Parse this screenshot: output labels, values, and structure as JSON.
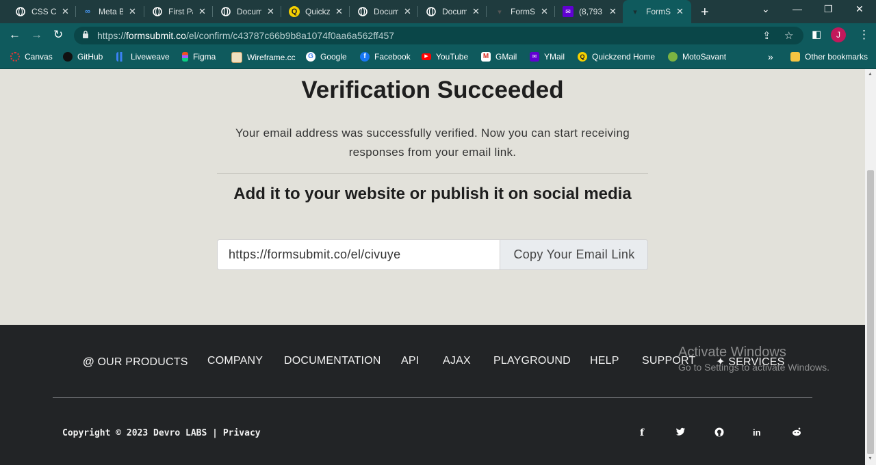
{
  "browser": {
    "tabs": [
      {
        "title": "CSS Ca",
        "icon": "globe-icon"
      },
      {
        "title": "Meta B",
        "icon": "meta-icon"
      },
      {
        "title": "First Pa",
        "icon": "globe-icon"
      },
      {
        "title": "Docum",
        "icon": "globe-icon"
      },
      {
        "title": "Quickz",
        "icon": "quickzend-icon"
      },
      {
        "title": "Docum",
        "icon": "globe-icon"
      },
      {
        "title": "Docum",
        "icon": "globe-icon"
      },
      {
        "title": "FormSu",
        "icon": "formsubmit-icon"
      },
      {
        "title": "(8,793",
        "icon": "yahoo-mail-icon"
      },
      {
        "title": "FormSu",
        "icon": "formsubmit-icon",
        "active": true
      }
    ],
    "url_prefix": "https://",
    "url_domain": "formsubmit.co",
    "url_path": "/el/confirm/c43787c66b9b8a1074f0aa6a562ff457",
    "profile_initial": "J",
    "bookmarks": [
      {
        "label": "Canvas"
      },
      {
        "label": "GitHub"
      },
      {
        "label": "Liveweave"
      },
      {
        "label": "Figma"
      },
      {
        "label": "Wireframe.cc"
      },
      {
        "label": "Google"
      },
      {
        "label": "Facebook"
      },
      {
        "label": "YouTube"
      },
      {
        "label": "GMail"
      },
      {
        "label": "YMail"
      },
      {
        "label": "Quickzend Home"
      },
      {
        "label": "MotoSavant"
      }
    ],
    "bookmarks_overflow": "»",
    "other_bookmarks": "Other bookmarks"
  },
  "main": {
    "title": "Verification Succeeded",
    "message": "Your email address was successfully verified. Now you can start receiving responses from your email link.",
    "subtitle": "Add it to your website or publish it on social media",
    "email_link": "https://formsubmit.co/el/civuye",
    "copy_button": "Copy Your Email Link"
  },
  "footer": {
    "nav": [
      {
        "label": "OUR PRODUCTS",
        "prefix": "@"
      },
      {
        "label": "COMPANY"
      },
      {
        "label": "DOCUMENTATION"
      },
      {
        "label": "API"
      },
      {
        "label": "AJAX"
      },
      {
        "label": "PLAYGROUND"
      },
      {
        "label": "HELP"
      },
      {
        "label": "SUPPORT"
      },
      {
        "label": "SERVICES",
        "prefix": "✦"
      }
    ],
    "copyright": "Copyright © 2023 Devro LABS",
    "divider": "|",
    "privacy": "Privacy",
    "social_icons": [
      "facebook-icon",
      "twitter-icon",
      "github-icon",
      "linkedin-icon",
      "reddit-icon"
    ]
  },
  "watermark": {
    "line1": "Activate Windows",
    "line2": "Go to Settings to activate Windows."
  }
}
